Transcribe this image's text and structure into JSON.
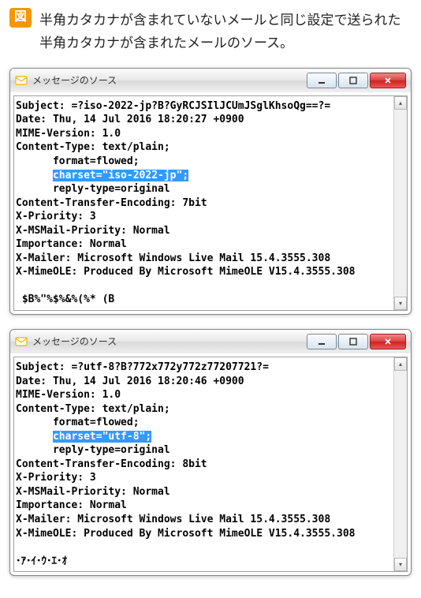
{
  "figure": {
    "badge": "図",
    "caption": "半角カタカナが含まれていないメールと同じ設定で送られた半角カタカナが含まれたメールのソース。"
  },
  "windows": [
    {
      "title": "メッセージのソース",
      "lines": [
        {
          "t": "Subject: =?iso-2022-jp?B?GyRCJSIlJCUmJSglKhsoQg==?="
        },
        {
          "t": "Date: Thu, 14 Jul 2016 18:20:27 +0900"
        },
        {
          "t": "MIME-Version: 1.0"
        },
        {
          "t": "Content-Type: text/plain;"
        },
        {
          "t": "      format=flowed;"
        },
        {
          "t": "      charset=\"iso-2022-jp\";",
          "hl": true
        },
        {
          "t": "      reply-type=original"
        },
        {
          "t": "Content-Transfer-Encoding: 7bit"
        },
        {
          "t": "X-Priority: 3"
        },
        {
          "t": "X-MSMail-Priority: Normal"
        },
        {
          "t": "Importance: Normal"
        },
        {
          "t": "X-Mailer: Microsoft Windows Live Mail 15.4.3555.308"
        },
        {
          "t": "X-MimeOLE: Produced By Microsoft MimeOLE V15.4.3555.308"
        },
        {
          "t": ""
        },
        {
          "t": " $B%\"%$%&%(%* (B"
        }
      ]
    },
    {
      "title": "メッセージのソース",
      "lines": [
        {
          "t": "Subject: =?utf-8?B?772x772y772z77207721?="
        },
        {
          "t": "Date: Thu, 14 Jul 2016 18:20:46 +0900"
        },
        {
          "t": "MIME-Version: 1.0"
        },
        {
          "t": "Content-Type: text/plain;"
        },
        {
          "t": "      format=flowed;"
        },
        {
          "t": "      charset=\"utf-8\";",
          "hl": true
        },
        {
          "t": "      reply-type=original"
        },
        {
          "t": "Content-Transfer-Encoding: 8bit"
        },
        {
          "t": "X-Priority: 3"
        },
        {
          "t": "X-MSMail-Priority: Normal"
        },
        {
          "t": "Importance: Normal"
        },
        {
          "t": "X-Mailer: Microsoft Windows Live Mail 15.4.3555.308"
        },
        {
          "t": "X-MimeOLE: Produced By Microsoft MimeOLE V15.4.3555.308"
        },
        {
          "t": ""
        },
        {
          "t": "･ｱ･ｲ･ｳ･ｴ･ｵ"
        }
      ]
    }
  ]
}
